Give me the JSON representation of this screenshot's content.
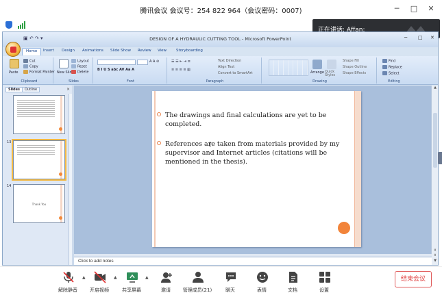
{
  "meeting": {
    "title": "腾讯会议 会议号：254 822 964（会议密码：0007)",
    "window_controls": [
      "─",
      "□",
      "✕"
    ],
    "speaker_label": "正在讲话: Affan;",
    "end_button": "结束会议",
    "toolbar": [
      {
        "label": "解除静音",
        "icon": "microphone-muted-icon"
      },
      {
        "label": "开启视频",
        "icon": "camera-off-icon"
      },
      {
        "label": "共享屏幕",
        "icon": "share-screen-icon"
      },
      {
        "label": "邀请",
        "icon": "invite-user-icon"
      },
      {
        "label": "管理成员(21)",
        "icon": "members-icon"
      },
      {
        "label": "聊天",
        "icon": "chat-icon"
      },
      {
        "label": "表情",
        "icon": "emoji-icon"
      },
      {
        "label": "文档",
        "icon": "document-icon"
      },
      {
        "label": "设置",
        "icon": "settings-icon"
      }
    ],
    "accent_red": "#e04040"
  },
  "ppt": {
    "title": "DESIGN OF A HYDRAULIC CUTTING TOOL - Microsoft PowerPoint",
    "tabs": [
      "Home",
      "Insert",
      "Design",
      "Animations",
      "Slide Show",
      "Review",
      "View",
      "Storyboarding"
    ],
    "ribbon": {
      "clipboard": {
        "label": "Clipboard",
        "paste": "Paste",
        "cut": "Cut",
        "copy": "Copy",
        "format_painter": "Format Painter"
      },
      "slides": {
        "label": "Slides",
        "new_slide": "New Slide",
        "layout": "Layout",
        "reset": "Reset",
        "delete": "Delete"
      },
      "font": {
        "label": "Font"
      },
      "paragraph": {
        "label": "Paragraph",
        "text_direction": "Text Direction",
        "align_text": "Align Text",
        "convert": "Convert to SmartArt"
      },
      "drawing": {
        "label": "Drawing",
        "arrange": "Arrange",
        "quick_styles": "Quick Styles",
        "shape_fill": "Shape Fill",
        "shape_outline": "Shape Outline",
        "shape_effects": "Shape Effects"
      },
      "editing": {
        "label": "Editing",
        "find": "Find",
        "replace": "Replace",
        "select": "Select"
      }
    },
    "pane": {
      "tabs": [
        "Slides",
        "Outline"
      ],
      "close": "×",
      "slide_numbers": [
        "13",
        "14"
      ],
      "thumb3_text": "Thank You"
    },
    "slide": {
      "bullets": [
        "The drawings and final calculations are yet to be completed.",
        "References are taken from materials provided by my supervisor and Internet articles (citations will be mentioned in the thesis)."
      ]
    },
    "notes_placeholder": "Click to add notes"
  }
}
